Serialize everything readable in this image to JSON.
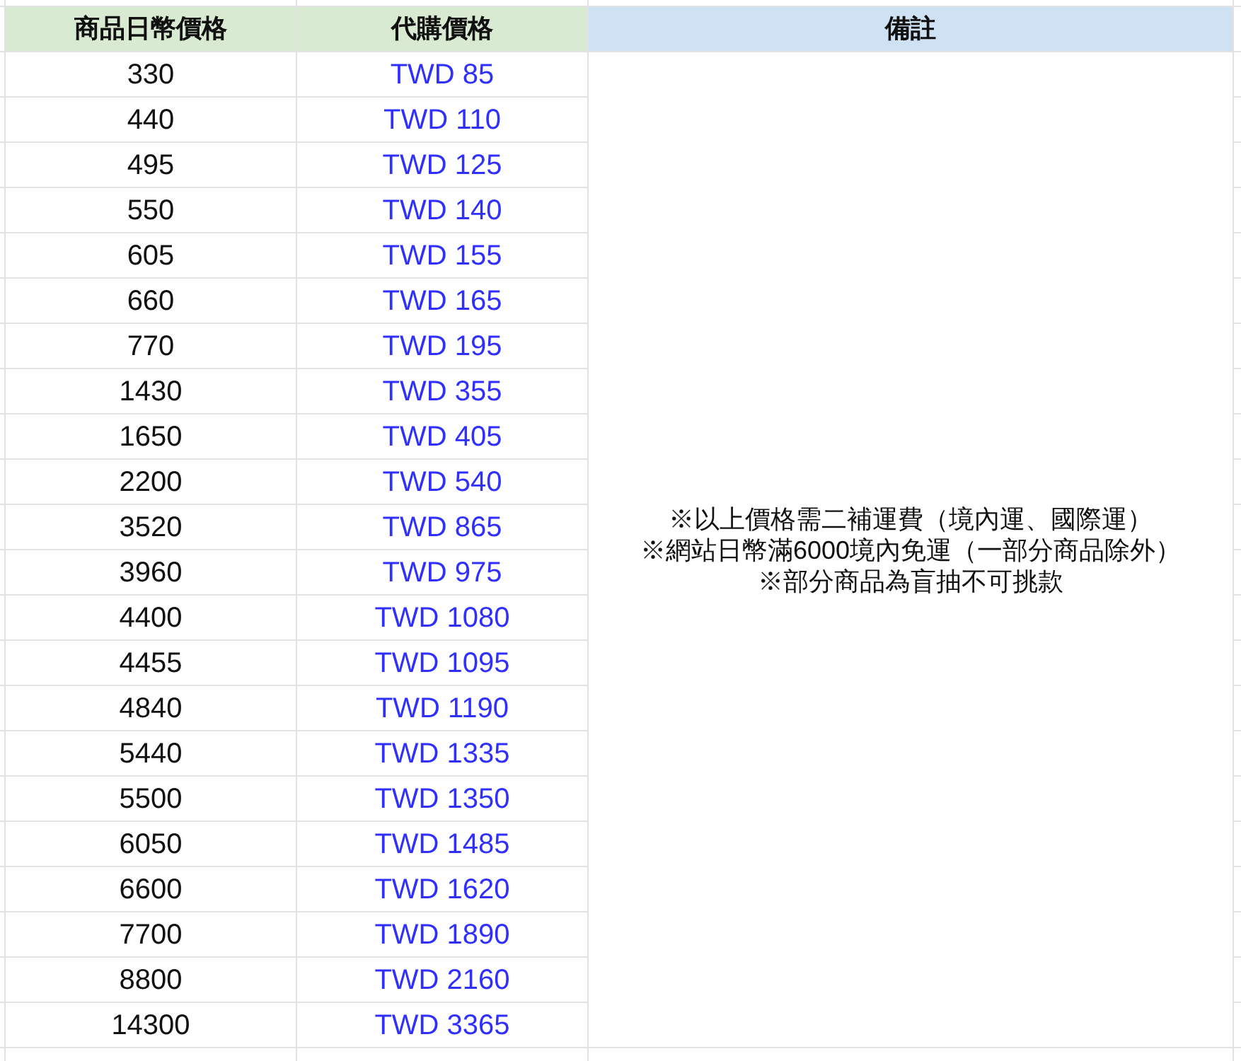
{
  "table": {
    "columns": [
      "商品日幣價格",
      "代購價格",
      "備註"
    ],
    "rows": [
      {
        "jpy": "330",
        "price": "TWD 85"
      },
      {
        "jpy": "440",
        "price": "TWD 110"
      },
      {
        "jpy": "495",
        "price": "TWD 125"
      },
      {
        "jpy": "550",
        "price": "TWD 140"
      },
      {
        "jpy": "605",
        "price": "TWD 155"
      },
      {
        "jpy": "660",
        "price": "TWD 165"
      },
      {
        "jpy": "770",
        "price": "TWD 195"
      },
      {
        "jpy": "1430",
        "price": "TWD 355"
      },
      {
        "jpy": "1650",
        "price": "TWD 405"
      },
      {
        "jpy": "2200",
        "price": "TWD 540"
      },
      {
        "jpy": "3520",
        "price": "TWD 865"
      },
      {
        "jpy": "3960",
        "price": "TWD 975"
      },
      {
        "jpy": "4400",
        "price": "TWD 1080"
      },
      {
        "jpy": "4455",
        "price": "TWD 1095"
      },
      {
        "jpy": "4840",
        "price": "TWD 1190"
      },
      {
        "jpy": "5440",
        "price": "TWD 1335"
      },
      {
        "jpy": "5500",
        "price": "TWD 1350"
      },
      {
        "jpy": "6050",
        "price": "TWD 1485"
      },
      {
        "jpy": "6600",
        "price": "TWD 1620"
      },
      {
        "jpy": "7700",
        "price": "TWD 1890"
      },
      {
        "jpy": "8800",
        "price": "TWD 2160"
      },
      {
        "jpy": "14300",
        "price": "TWD 3365"
      }
    ],
    "note": [
      "※以上價格需二補運費（境內運、國際運）",
      "※網站日幣滿6000境內免運（一部分商品除外）",
      "※部分商品為盲抽不可挑款"
    ]
  }
}
